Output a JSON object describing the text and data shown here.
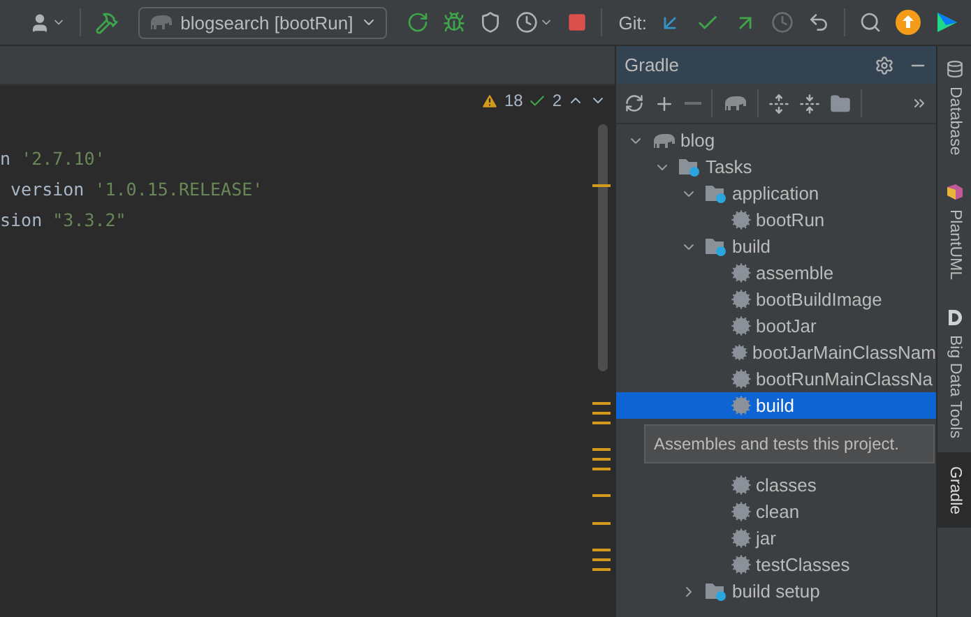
{
  "toolbar": {
    "items": [
      {
        "kind": "user"
      },
      {
        "kind": "build"
      },
      {
        "kind": "run_config",
        "label": "blogsearch [bootRun]"
      },
      {
        "kind": "rerun"
      },
      {
        "kind": "debug"
      },
      {
        "kind": "coverage"
      },
      {
        "kind": "profile"
      },
      {
        "kind": "stop"
      },
      {
        "kind": "git_label",
        "label": "Git:"
      },
      {
        "kind": "update"
      },
      {
        "kind": "commit"
      },
      {
        "kind": "push"
      },
      {
        "kind": "history",
        "disabled": true
      },
      {
        "kind": "rollback"
      },
      {
        "kind": "search"
      },
      {
        "kind": "upgrade"
      },
      {
        "kind": "toolbox"
      }
    ]
  },
  "editor": {
    "warnings": "18",
    "typos": "2",
    "lines": [
      {
        "code": "n ",
        "string": "'2.7.10'"
      },
      {
        "code": " version ",
        "string": "'1.0.15.RELEASE'"
      },
      {
        "code": "sion ",
        "string": "\"3.3.2\""
      }
    ]
  },
  "gradle": {
    "title": "Gradle",
    "toolbar": [
      {
        "kind": "refresh"
      },
      {
        "kind": "add"
      },
      {
        "kind": "remove",
        "disabled": true
      },
      {
        "kind": "elephant"
      },
      {
        "kind": "expand"
      },
      {
        "kind": "collapse"
      },
      {
        "kind": "folder"
      },
      {
        "kind": "more"
      }
    ],
    "tree": [
      {
        "kind": "project",
        "label": "blog",
        "expanded": true,
        "selected": false,
        "children": [
          {
            "kind": "folder",
            "label": "Tasks",
            "expanded": true,
            "selected": false,
            "children": [
              {
                "kind": "folder",
                "label": "application",
                "expanded": true,
                "selected": false,
                "children": [
                  {
                    "kind": "task",
                    "label": "bootRun",
                    "selected": false
                  }
                ]
              },
              {
                "kind": "folder",
                "label": "build",
                "expanded": true,
                "selected": false,
                "children": [
                  {
                    "kind": "task",
                    "label": "assemble",
                    "selected": false
                  },
                  {
                    "kind": "task",
                    "label": "bootBuildImage",
                    "selected": false
                  },
                  {
                    "kind": "task",
                    "label": "bootJar",
                    "selected": false
                  },
                  {
                    "kind": "task",
                    "label": "bootJarMainClassNam",
                    "selected": false
                  },
                  {
                    "kind": "task",
                    "label": "bootRunMainClassNa",
                    "selected": false
                  },
                  {
                    "kind": "task",
                    "label": "build",
                    "selected": true,
                    "tooltip": "Assembles and tests this project."
                  },
                  {
                    "kind": "task",
                    "label": "classes",
                    "selected": false
                  },
                  {
                    "kind": "task",
                    "label": "clean",
                    "selected": false
                  },
                  {
                    "kind": "task",
                    "label": "jar",
                    "selected": false
                  },
                  {
                    "kind": "task",
                    "label": "testClasses",
                    "selected": false
                  }
                ]
              },
              {
                "kind": "folder",
                "label": "build setup",
                "expanded": false,
                "selected": false
              }
            ]
          }
        ]
      }
    ]
  },
  "side_tabs": [
    {
      "kind": "database",
      "label": "Database",
      "selected": false
    },
    {
      "kind": "plantuml",
      "label": "PlantUML",
      "selected": false
    },
    {
      "kind": "bigdata",
      "label": "Big Data Tools",
      "selected": false
    },
    {
      "kind": "gradle",
      "label": "Gradle",
      "selected": true
    }
  ]
}
